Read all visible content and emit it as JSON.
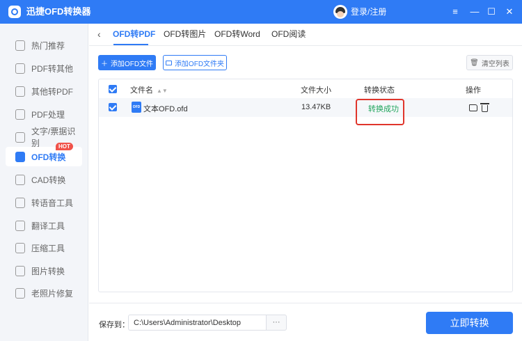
{
  "window": {
    "title": "迅捷OFD转换器",
    "login_text": "登录/注册",
    "controls": [
      "≡",
      "—",
      "☐",
      "✕"
    ]
  },
  "sidebar": {
    "items": [
      {
        "label": "热门推荐",
        "icon": "thumb-up-icon"
      },
      {
        "label": "PDF转其他",
        "icon": "pdf-icon"
      },
      {
        "label": "其他转PDF",
        "icon": "convert-pdf-icon"
      },
      {
        "label": "PDF处理",
        "icon": "pdf-tool-icon"
      },
      {
        "label": "文字/票据识别",
        "icon": "ocr-icon"
      },
      {
        "label": "OFD转换",
        "icon": "ofd-icon",
        "active": true,
        "badge": "HOT"
      },
      {
        "label": "CAD转换",
        "icon": "cad-icon"
      },
      {
        "label": "转语音工具",
        "icon": "voice-icon"
      },
      {
        "label": "翻译工具",
        "icon": "translate-icon"
      },
      {
        "label": "压缩工具",
        "icon": "compress-icon"
      },
      {
        "label": "图片转换",
        "icon": "image-icon"
      },
      {
        "label": "老照片修复",
        "icon": "photo-repair-icon"
      }
    ]
  },
  "tabs": {
    "back_icon": "‹",
    "items": [
      {
        "label": "OFD转PDF",
        "active": true
      },
      {
        "label": "OFD转图片"
      },
      {
        "label": "OFD转Word"
      },
      {
        "label": "OFD阅读"
      }
    ]
  },
  "toolbar": {
    "add_file": "添加OFD文件",
    "add_folder": "添加OFD文件夹",
    "clear_list": "清空列表"
  },
  "table": {
    "headers": {
      "name": "文件名",
      "size": "文件大小",
      "status": "转换状态",
      "action": "操作"
    },
    "rows": [
      {
        "name": "文本OFD.ofd",
        "size": "13.47KB",
        "status": "转换成功",
        "file_icon_text": "OFD"
      }
    ]
  },
  "footer": {
    "save_label": "保存到：",
    "path": "C:\\Users\\Administrator\\Desktop",
    "browse": "···",
    "convert": "立即转换"
  },
  "colors": {
    "primary": "#2f7bf5",
    "success": "#20a55c",
    "highlight": "#e0352b",
    "hot_badge": "#f0524a"
  }
}
